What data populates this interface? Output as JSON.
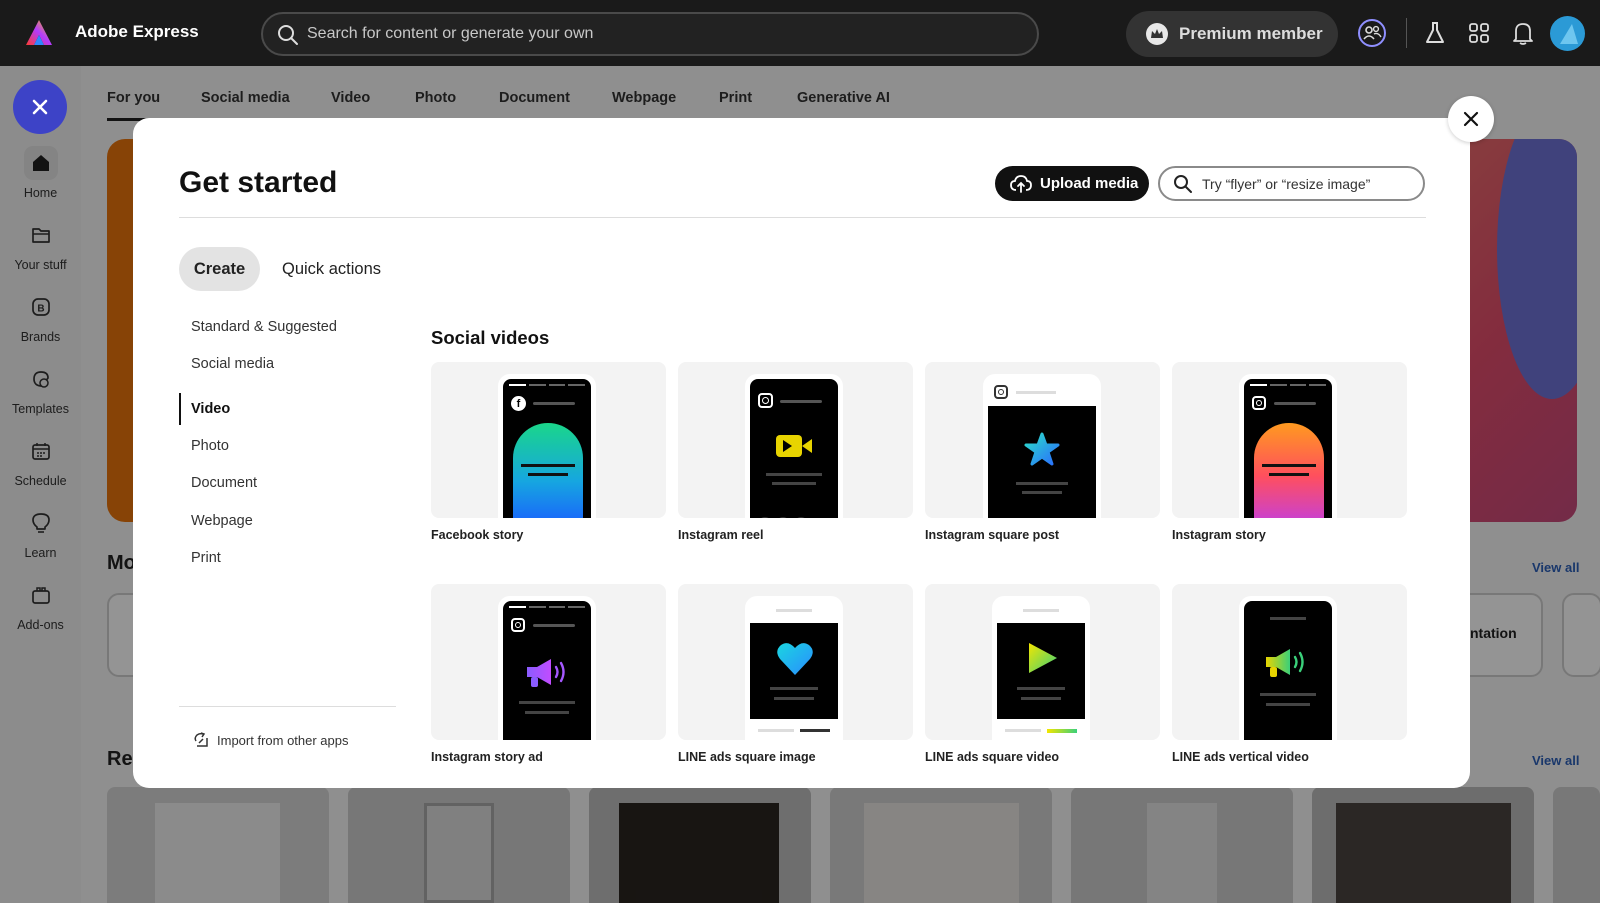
{
  "app": {
    "title": "Adobe Express"
  },
  "search": {
    "placeholder": "Search for content or generate your own"
  },
  "header": {
    "premium_label": "Premium member"
  },
  "rail": {
    "items": [
      {
        "label": "Home"
      },
      {
        "label": "Your stuff"
      },
      {
        "label": "Brands"
      },
      {
        "label": "Templates"
      },
      {
        "label": "Schedule"
      },
      {
        "label": "Learn"
      },
      {
        "label": "Add-ons"
      }
    ]
  },
  "background": {
    "tabs": [
      {
        "label": "For you"
      },
      {
        "label": "Social media"
      },
      {
        "label": "Video"
      },
      {
        "label": "Photo"
      },
      {
        "label": "Document"
      },
      {
        "label": "Webpage"
      },
      {
        "label": "Print"
      },
      {
        "label": "Generative AI"
      }
    ],
    "section_one_heading": "Mo",
    "section_two_heading": "Rec",
    "view_all": "View all",
    "card_partial_label": "ntation"
  },
  "modal": {
    "title": "Get started",
    "upload_label": "Upload media",
    "search_placeholder": "Try “flyer” or “resize image”",
    "tabs": {
      "create": "Create",
      "quick_actions": "Quick actions"
    },
    "categories": [
      {
        "label": "Standard & Suggested"
      },
      {
        "label": "Social media"
      },
      {
        "label": "Video"
      },
      {
        "label": "Photo"
      },
      {
        "label": "Document"
      },
      {
        "label": "Webpage"
      },
      {
        "label": "Print"
      }
    ],
    "import_label": "Import from other apps",
    "section_title": "Social videos",
    "templates": [
      {
        "label": "Facebook story"
      },
      {
        "label": "Instagram reel"
      },
      {
        "label": "Instagram square post"
      },
      {
        "label": "Instagram story"
      },
      {
        "label": "Instagram story ad"
      },
      {
        "label": "LINE ads square image"
      },
      {
        "label": "LINE ads square video"
      },
      {
        "label": "LINE ads vertical video"
      }
    ]
  },
  "colors": {
    "topbar": "#1a1a1a",
    "fab": "#3d43c7",
    "link": "#2b5fb8",
    "hero_orange": "#e8740c"
  }
}
